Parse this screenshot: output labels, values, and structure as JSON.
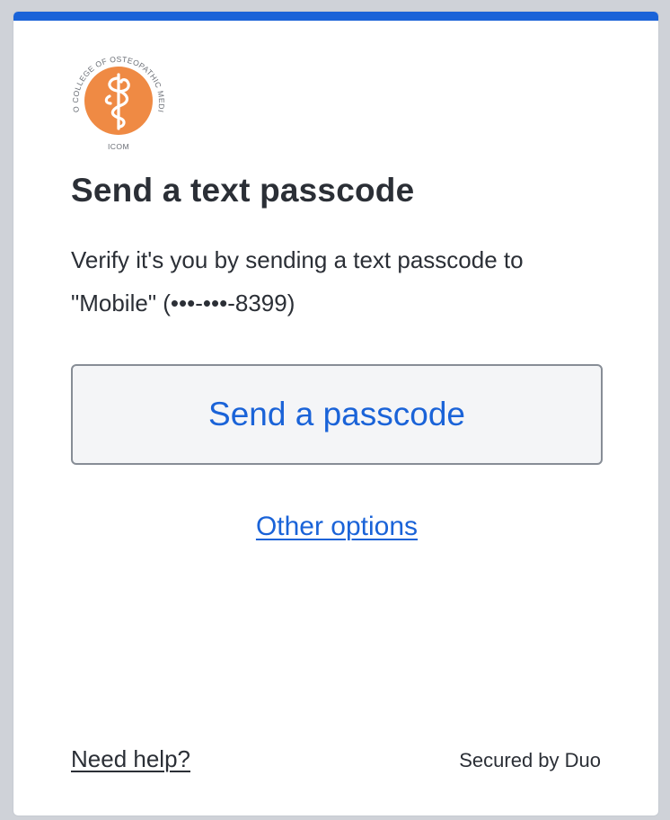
{
  "colors": {
    "accent": "#1a63d8",
    "logo_orange": "#ef8a44",
    "text": "#2b2f36",
    "button_border": "#878d96",
    "button_bg": "#f4f5f7"
  },
  "logo": {
    "icon": "caduceus-logo-icon",
    "arc_text": "IDAHO COLLEGE OF OSTEOPATHIC MEDICINE",
    "bottom_text": "ICOM"
  },
  "heading": {
    "title": "Send a text passcode"
  },
  "body": {
    "description": "Verify it's you by sending a text passcode to \"Mobile\" (•••-•••-8399)"
  },
  "actions": {
    "send_button_label": "Send a passcode",
    "other_options_label": "Other options"
  },
  "footer": {
    "help_label": "Need help?",
    "secured_label": "Secured by Duo"
  }
}
